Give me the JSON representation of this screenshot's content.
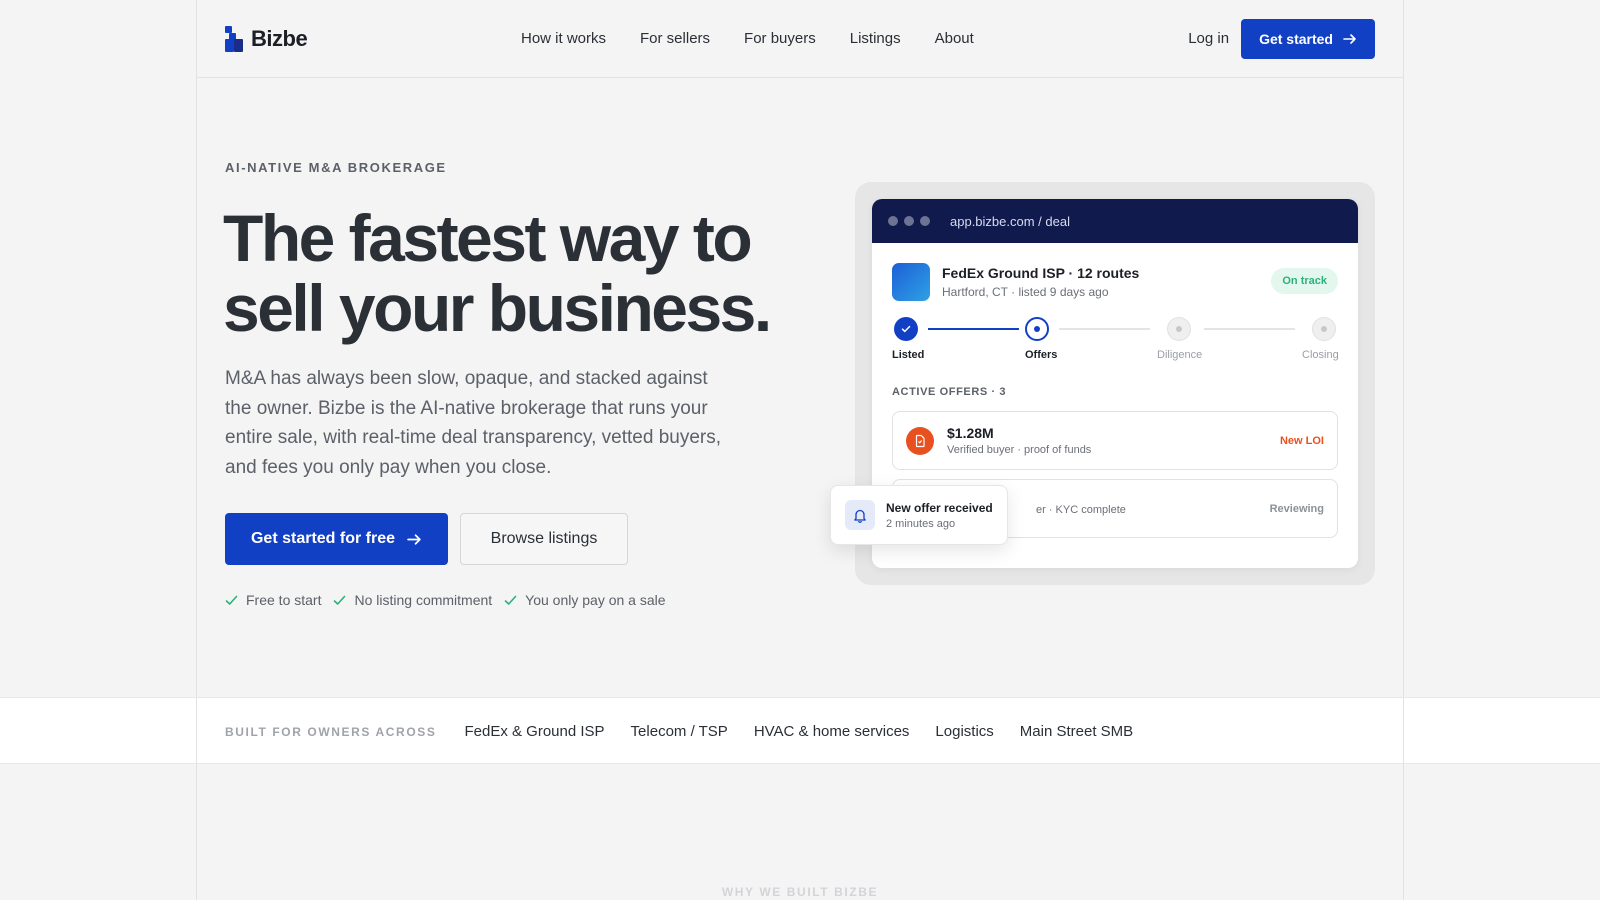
{
  "nav": {
    "logo": "Bizbe",
    "links": [
      "How it works",
      "For sellers",
      "For buyers",
      "Listings",
      "About"
    ],
    "login": "Log in",
    "cta": "Get started"
  },
  "hero": {
    "eyebrow": "AI-NATIVE M&A BROKERAGE",
    "headline_line1": "The fastest way to",
    "headline_line2": "sell your business.",
    "subtext": "M&A has always been slow, opaque, and stacked against the owner. Bizbe is the AI-native brokerage that runs your entire sale, with real-time deal transparency, vetted buyers, and fees you only pay when you close.",
    "primary_cta": "Get started for free",
    "secondary_cta": "Browse listings",
    "checks": [
      "Free to start",
      "No listing commitment",
      "You only pay on a sale"
    ]
  },
  "mock": {
    "url": "app.bizbe.com / deal",
    "deal_title": "FedEx Ground ISP · 12 routes",
    "deal_sub": "Hartford, CT · listed 9 days ago",
    "status": "On track",
    "steps": [
      "Listed",
      "Offers",
      "Diligence",
      "Closing"
    ],
    "offers_header": "ACTIVE OFFERS · 3",
    "offers": [
      {
        "amount": "$1.28M",
        "sub": "Verified buyer · proof of funds",
        "status": "New LOI"
      },
      {
        "amount": "",
        "sub": "er · KYC complete",
        "status": "Reviewing"
      }
    ],
    "toast": {
      "title": "New offer received",
      "sub": "2 minutes ago"
    }
  },
  "strip": {
    "label": "BUILT FOR OWNERS ACROSS",
    "items": [
      "FedEx & Ground ISP",
      "Telecom / TSP",
      "HVAC & home services",
      "Logistics",
      "Main Street SMB"
    ]
  },
  "next_section": {
    "eyebrow": "WHY WE BUILT BIZBE"
  },
  "colors": {
    "accent": "#1240c4",
    "navy": "#111a4c",
    "success": "#29b27a",
    "alert": "#e8501f"
  }
}
